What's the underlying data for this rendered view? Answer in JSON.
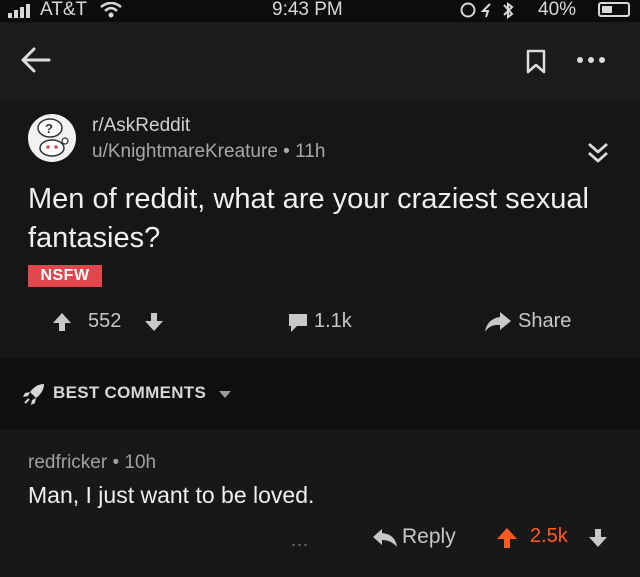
{
  "status_bar": {
    "carrier": "AT&T",
    "time": "9:43 PM",
    "battery": "40%",
    "battery_level": 0.4
  },
  "post": {
    "subreddit": "r/AskReddit",
    "author": "u/KnightmareKreature",
    "separator": "•",
    "age": "11h",
    "title": "Men of reddit, what are your craziest sexual fantasies?",
    "badge": "NSFW",
    "upvotes": "552",
    "comments": "1.1k",
    "share_label": "Share"
  },
  "sort": {
    "label": "BEST COMMENTS"
  },
  "comment": {
    "author": "redfricker",
    "separator": "•",
    "age": "10h",
    "body": "Man, I just want to be loved.",
    "more": "...",
    "reply_label": "Reply",
    "score": "2.5k"
  },
  "colors": {
    "background": "#141414",
    "nsfw": "#e0464c",
    "upvote": "#ff5a1f",
    "text": "#e9e9e9"
  },
  "icons": [
    "back-arrow-icon",
    "bookmark-icon",
    "more-dots-icon",
    "collapse-chevrons-icon",
    "upvote-arrow-icon",
    "downvote-arrow-icon",
    "comment-bubble-icon",
    "share-arrow-icon",
    "rocket-sort-icon",
    "reply-arrow-icon"
  ]
}
